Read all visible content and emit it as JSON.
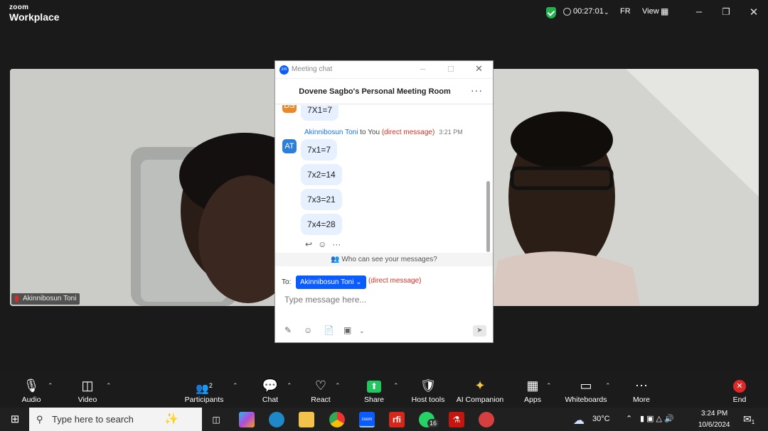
{
  "titlebar": {
    "logo_top": "zoom",
    "logo_bottom": "Workplace",
    "timer": "00:27:01",
    "language": "FR",
    "view_label": "View"
  },
  "participants": {
    "left_name": "Akinnibosun Toni"
  },
  "chat": {
    "window_title": "Meeting chat",
    "room_title": "Dovene Sagbo's Personal Meeting Room",
    "prev_avatar": "DS",
    "prev_message": "7X1=7",
    "sender_name": "Akinnibosun Toni",
    "sender_to": " to You ",
    "sender_dm": "(direct message)",
    "sender_time": "3:21 PM",
    "sender_avatar": "AT",
    "messages": [
      "7x1=7",
      "7x2=14",
      "7x3=21",
      "7x4=28"
    ],
    "who_can_see": "Who can see your messages?",
    "to_label": "To:",
    "to_recipient": "Akinnibosun Toni",
    "to_dm": "(direct message)",
    "input_placeholder": "Type message here..."
  },
  "toolbar": {
    "audio": "Audio",
    "video": "Video",
    "participants": "Participants",
    "participants_count": "2",
    "chat": "Chat",
    "react": "React",
    "share": "Share",
    "host_tools": "Host tools",
    "ai_companion": "AI Companion",
    "apps": "Apps",
    "whiteboards": "Whiteboards",
    "more": "More",
    "end": "End"
  },
  "taskbar": {
    "search_placeholder": "Type here to search",
    "weather": "30°C",
    "time": "3:24 PM",
    "date": "10/6/2024",
    "whatsapp_badge": "16",
    "notification_badge": "1"
  },
  "colors": {
    "zoom_blue": "#0b5cff",
    "share_green": "#22c55e",
    "end_red": "#e02828"
  }
}
